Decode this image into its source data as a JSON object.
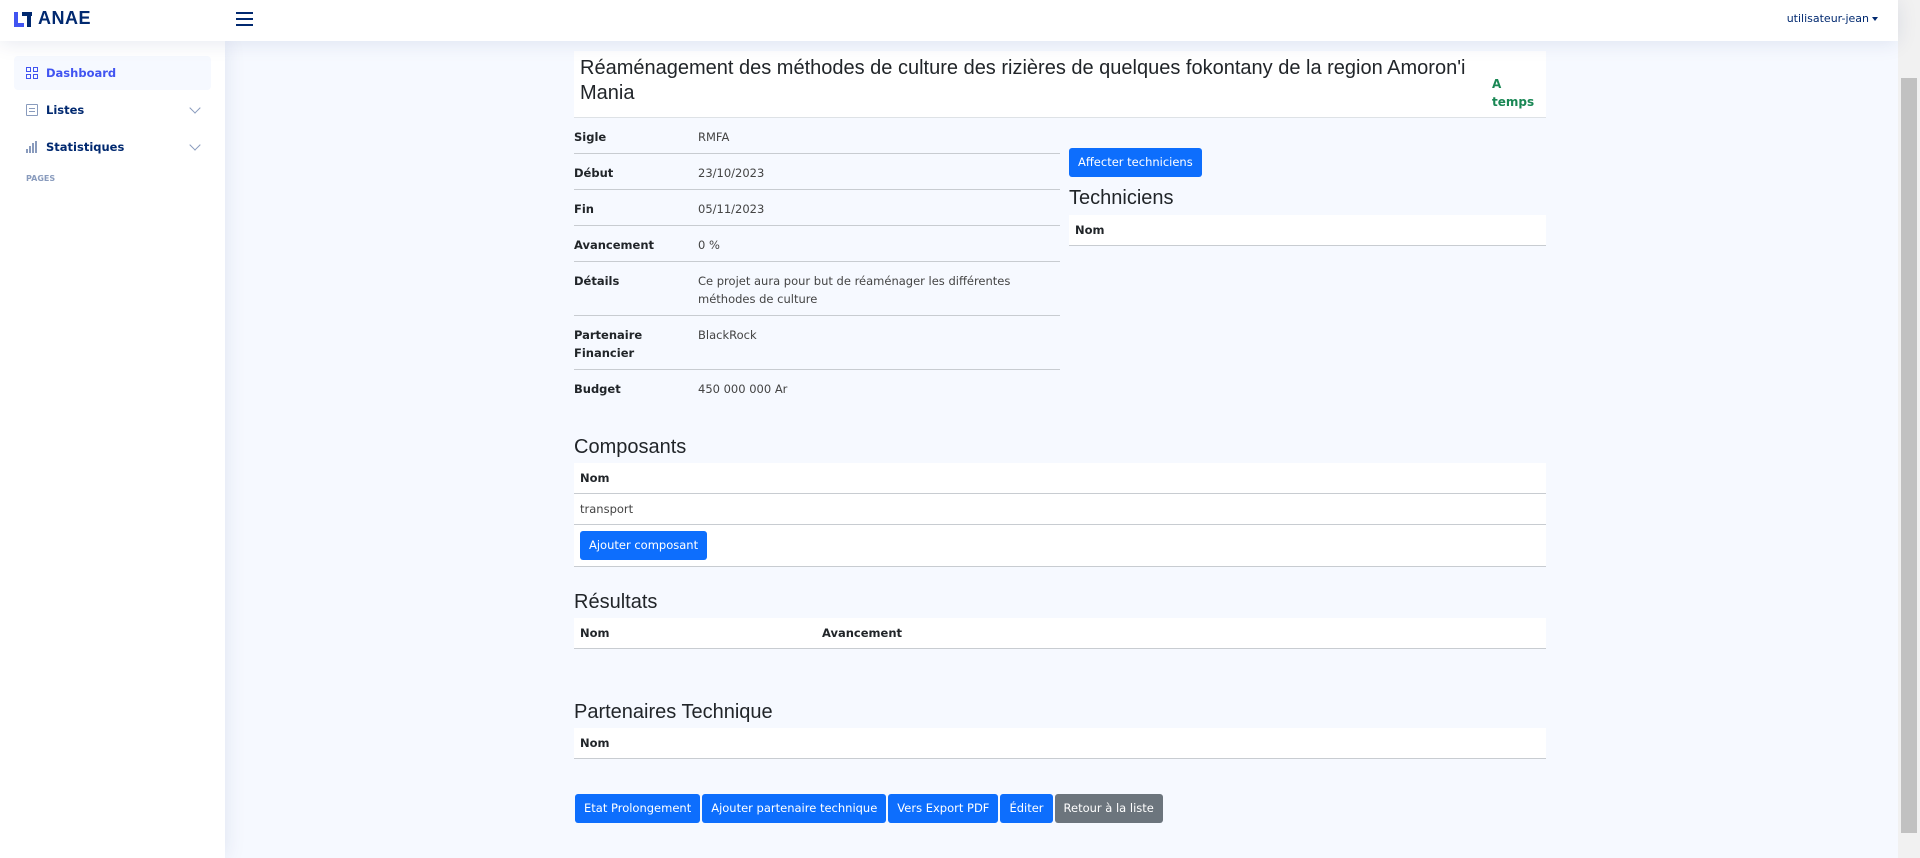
{
  "header": {
    "logo_text": "ANAE",
    "user_label": "utilisateur-jean"
  },
  "sidebar": {
    "items": [
      {
        "label": "Dashboard",
        "icon": "grid-icon",
        "active": true
      },
      {
        "label": "Listes",
        "icon": "list-icon",
        "expandable": true
      },
      {
        "label": "Statistiques",
        "icon": "bar-chart-icon",
        "expandable": true
      }
    ],
    "heading": "PAGES"
  },
  "project": {
    "title": "Réaménagement des méthodes de culture des rizières de quelques fokontany de la region Amoron'i Mania",
    "status": "A temps",
    "status_color": "#198754",
    "details": [
      {
        "label": "Sigle",
        "value": "RMFA"
      },
      {
        "label": "Début",
        "value": "23/10/2023"
      },
      {
        "label": "Fin",
        "value": "05/11/2023"
      },
      {
        "label": "Avancement",
        "value": "0 %"
      },
      {
        "label": "Détails",
        "value": "Ce projet aura pour but de réaménager les différentes méthodes de culture"
      },
      {
        "label": "Partenaire Financier",
        "value": "BlackRock"
      },
      {
        "label": "Budget",
        "value": "450 000 000 Ar"
      }
    ]
  },
  "techniciens": {
    "assign_button": "Affecter techniciens",
    "heading": "Techniciens",
    "column": "Nom"
  },
  "composants": {
    "heading": "Composants",
    "column": "Nom",
    "rows": [
      "transport"
    ],
    "add_button": "Ajouter composant"
  },
  "resultats": {
    "heading": "Résultats",
    "columns": [
      "Nom",
      "Avancement"
    ]
  },
  "partenaires": {
    "heading": "Partenaires Technique",
    "column": "Nom"
  },
  "actions": {
    "etat_prolongement": "Etat Prolongement",
    "ajouter_partenaire": "Ajouter partenaire technique",
    "export_pdf": "Vers Export PDF",
    "editer": "Éditer",
    "retour": "Retour à la liste"
  },
  "colors": {
    "primary": "#0d6efd",
    "secondary": "#6c757d",
    "brand": "#4154f1",
    "navy": "#012970",
    "background": "#f6f9ff"
  }
}
